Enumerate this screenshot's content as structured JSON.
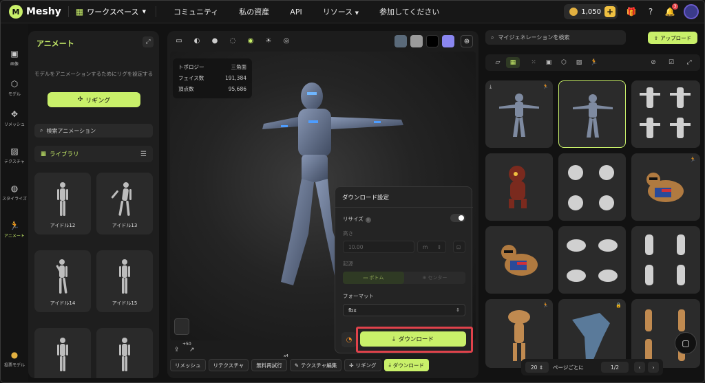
{
  "app": {
    "name": "Meshy"
  },
  "nav": {
    "workspace": "ワークスペース",
    "items": [
      "コミュニティ",
      "私の資産",
      "API",
      "リソース",
      "参加してください"
    ],
    "credits": "1,050",
    "notif_count": "3"
  },
  "rail": {
    "items": [
      {
        "label": "画像",
        "icon": "image-icon"
      },
      {
        "label": "モデル",
        "icon": "cube-icon"
      },
      {
        "label": "リメッシュ",
        "icon": "remesh-icon"
      },
      {
        "label": "テクスチャ",
        "icon": "texture-icon"
      },
      {
        "label": "スタイライズ",
        "icon": "stylize-icon"
      },
      {
        "label": "アニメート",
        "icon": "running-icon"
      }
    ],
    "bottom": "投票モデル"
  },
  "animate": {
    "title": "アニメート",
    "description": "モデルをアニメーションするためにリグを設定する",
    "rig_button": "リギング",
    "search_placeholder": "検索アニメーション",
    "library": "ライブラリ",
    "cards": [
      "アイドル12",
      "アイドル13",
      "アイドル14",
      "アイドル15",
      "",
      ""
    ]
  },
  "viewer": {
    "stats": {
      "topology_label": "トポロジー",
      "topology_value": "三角面",
      "faces_label": "フェイス数",
      "faces_value": "191,384",
      "verts_label": "頂点数",
      "verts_value": "95,686"
    },
    "swatch_colors": [
      "#5a6a7a",
      "#9a9a9a",
      "#000000",
      "#8a86f0"
    ],
    "plus50": "+50",
    "tabs": [
      "リメッシュ",
      "リテクスチャ",
      "無料再試行",
      "テクスチャ編集",
      "リギング",
      "ダウンロード"
    ],
    "retry_badge": "x4"
  },
  "download": {
    "title": "ダウンロード設定",
    "resize": "リサイズ",
    "height": "高さ",
    "height_value": "10.00",
    "unit": "m",
    "origin": "起源",
    "origin_bottom": "ボトム",
    "origin_center": "センター",
    "format": "フォーマット",
    "format_value": "fbx",
    "button": "ダウンロード"
  },
  "right": {
    "search_placeholder": "マイジェネレーションを検索",
    "upload": "アップロード",
    "pager": {
      "per_page": "20",
      "per_page_label": "ページごとに",
      "page": "1/2"
    }
  }
}
